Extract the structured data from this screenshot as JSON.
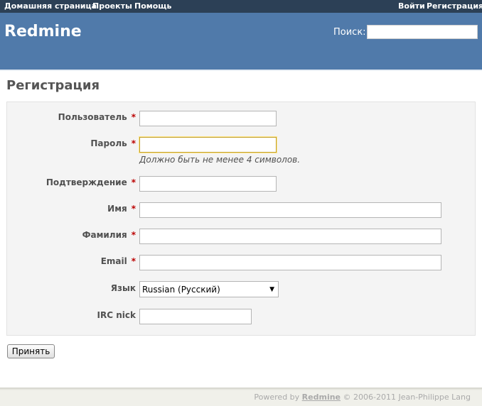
{
  "top_menu": {
    "left_items": [
      "Домашняя страница",
      "Проекты",
      "Помощь"
    ],
    "right_items": [
      "Войти",
      "Регистрация"
    ]
  },
  "header": {
    "app_title": "Redmine",
    "search_label": "Поиск:",
    "search_value": ""
  },
  "page": {
    "title": "Регистрация"
  },
  "form": {
    "username_label": "Пользователь",
    "password_label": "Пароль",
    "password_hint": "Должно быть не менее 4 символов.",
    "confirmation_label": "Подтверждение",
    "firstname_label": "Имя",
    "lastname_label": "Фамилия",
    "email_label": "Email",
    "language_label": "Язык",
    "language_value": "Russian (Русский)",
    "irc_label": "IRC nick",
    "required_marker": "*",
    "submit_label": "Принять"
  },
  "footer": {
    "prefix": "Powered by",
    "link": "Redmine",
    "suffix": "© 2006-2011 Jean-Philippe Lang"
  },
  "colors": {
    "top_menu_bg": "#2C4056",
    "header_bg": "#507AAA",
    "required": "#bb0000"
  }
}
